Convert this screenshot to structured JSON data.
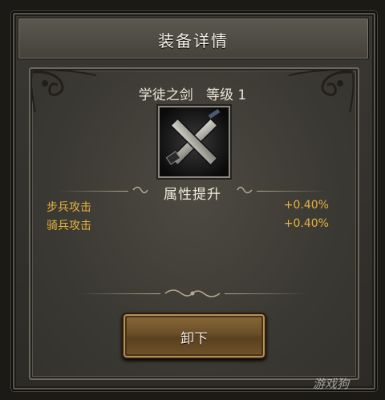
{
  "header": {
    "title": "装备详情"
  },
  "item": {
    "name": "学徒之剑",
    "level_label": "等级",
    "level": "1",
    "icon": "crossed-swords-icon"
  },
  "attributes": {
    "section_title": "属性提升",
    "rows": [
      {
        "name": "步兵攻击",
        "value": "+0.40%"
      },
      {
        "name": "骑兵攻击",
        "value": "+0.40%"
      }
    ]
  },
  "actions": {
    "unequip_label": "卸下"
  },
  "watermark": "游戏狗",
  "colors": {
    "accent": "#e6b43e",
    "button": "#6b4f28"
  }
}
